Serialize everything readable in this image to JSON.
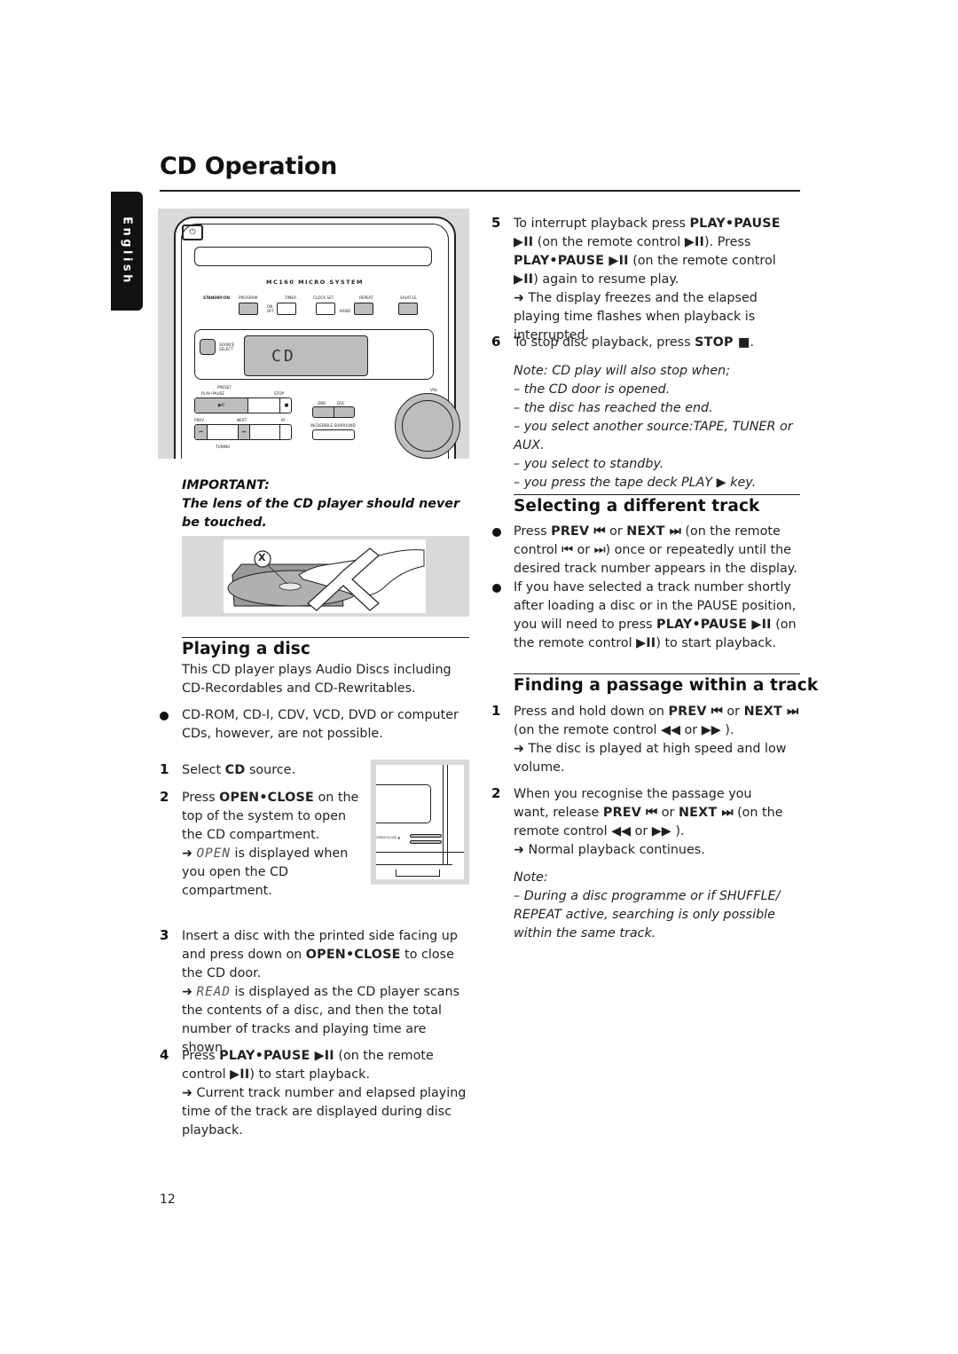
{
  "page": {
    "title": "CD Operation",
    "language_tab": "English",
    "page_number": "12"
  },
  "device_figure": {
    "model": "MC160 MICRO SYSTEM",
    "buttons_top": [
      "STANDBY-ON",
      "PROGRAM",
      "TIMER",
      "CLOCK SET",
      "REPEAT",
      "SHUFFLE"
    ],
    "timer_sub": "ON OFF",
    "band_label": "BAND",
    "source_select": "SOURCE SELECT",
    "lcd": "CD",
    "preset_label": "PRESET",
    "play_pause": "PLAY•PAUSE",
    "stop": "STOP",
    "prev": "PREV",
    "next": "NEXT",
    "ir": "IR",
    "tuning": "TUNING",
    "dbb": "DBB",
    "dsc": "DSC",
    "incredible_surround": "INCREDIBLE SURROUND",
    "vol": "VOL",
    "power_symbol": "⏻"
  },
  "important": {
    "heading": "IMPORTANT:",
    "text": "The lens of the CD player should never be touched."
  },
  "lens_figure": {
    "marker": "X"
  },
  "playing_a_disc": {
    "heading": "Playing a disc",
    "intro": "This CD player plays Audio Discs including CD-Recordables and CD-Rewritables.",
    "bullet": "CD-ROM, CD-I, CDV, VCD, DVD or computer CDs, however, are not possible.",
    "steps": [
      {
        "num": "1",
        "pre": "Select ",
        "bold": "CD",
        "post": " source."
      },
      {
        "num": "2",
        "pre": "Press ",
        "bold": "OPEN•CLOSE",
        "post": " on the top of the system to open the CD compartment.",
        "result_lcd": "OPEN",
        "result": " is displayed when you open the CD compartment."
      },
      {
        "num": "3",
        "pre": "Insert a disc with the printed side facing up and press down on ",
        "bold": "OPEN•CLOSE",
        "post": " to close the CD door.",
        "result_lcd": "READ",
        "result": " is displayed as the CD player scans the contents of a disc, and then the total number of tracks and playing time are shown."
      },
      {
        "num": "4",
        "pre": "Press ",
        "bold": "PLAY•PAUSE ▶II",
        "post": " (on the remote control ",
        "bold2": "▶II",
        "post2": ") to start playback.",
        "result": "Current track number and elapsed playing time of the track are displayed during disc playback."
      },
      {
        "num": "5",
        "pre": "To interrupt playback press ",
        "bold": "PLAY•PAUSE ▶II",
        "post": " (on the remote control ",
        "bold2": "▶II",
        "post2": "). Press ",
        "bold3": "PLAY•PAUSE ▶II",
        "post3": " (on the remote control ",
        "bold4": "▶II",
        "post4": ") again to resume play.",
        "result": "The display freezes and the elapsed playing time flashes when playback is interrupted."
      },
      {
        "num": "6",
        "pre": "To stop disc playback, press ",
        "bold": "STOP ■",
        "post": "."
      }
    ],
    "top_figure_label": "OPEN•CLOSE ▲",
    "arrow": "➜"
  },
  "stop_note": {
    "heading": "Note: CD play will also stop when;",
    "items": [
      "– the CD door is opened.",
      "– the disc has reached the end.",
      "– you select another source:TAPE, TUNER or AUX.",
      "– you select to standby.",
      "– you press the tape deck PLAY ▶ key."
    ]
  },
  "selecting_track": {
    "heading": "Selecting a different track",
    "bullets": [
      {
        "pre": "Press ",
        "bold": "PREV ⏮",
        "mid": " or ",
        "bold2": "NEXT ⏭",
        "post": " (on the remote control ⏮ or ⏭) once or repeatedly until the desired track number appears in the display."
      },
      {
        "pre": "If you have selected a track number shortly after loading a disc or in the PAUSE position, you will need to press ",
        "bold": "PLAY•PAUSE ▶II",
        "mid": " (on the remote control ",
        "bold2": "▶II",
        "post": ") to start playback."
      }
    ]
  },
  "finding_passage": {
    "heading": "Finding a passage within a track",
    "steps": [
      {
        "num": "1",
        "pre": "Press and hold down on ",
        "bold": "PREV ⏮",
        "mid": " or ",
        "bold2": "NEXT ⏭",
        "post": " (on the remote control ◀◀ or ▶▶ ).",
        "result": "The disc is played at high speed and low volume."
      },
      {
        "num": "2",
        "pre": "When you recognise the passage you want, release ",
        "bold": "PREV ⏮",
        "mid": " or ",
        "bold2": "NEXT ⏭",
        "post": " (on the remote control ◀◀ or ▶▶ ).",
        "result": "Normal playback continues."
      }
    ],
    "note_heading": "Note:",
    "note_text": "– During a disc programme or if SHUFFLE/ REPEAT active, searching is only possible within the same track."
  }
}
